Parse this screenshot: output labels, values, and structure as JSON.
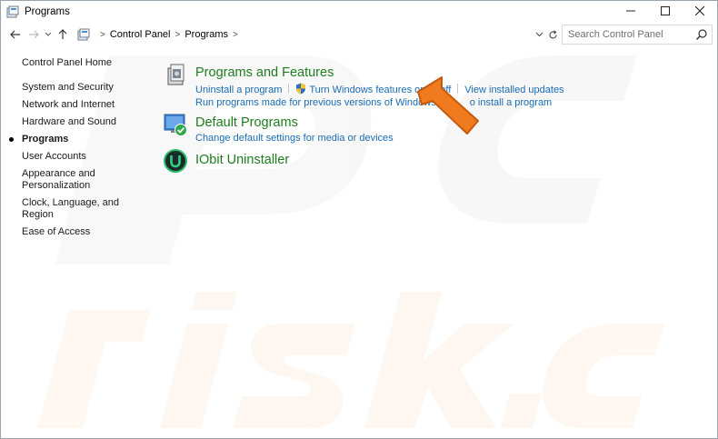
{
  "window": {
    "title": "Programs"
  },
  "addressbar": {
    "breadcrumbs": [
      "Control Panel",
      "Programs"
    ],
    "search_placeholder": "Search Control Panel"
  },
  "leftnav": {
    "home": "Control Panel Home",
    "items": [
      {
        "label": "System and Security",
        "active": false
      },
      {
        "label": "Network and Internet",
        "active": false
      },
      {
        "label": "Hardware and Sound",
        "active": false
      },
      {
        "label": "Programs",
        "active": true
      },
      {
        "label": "User Accounts",
        "active": false
      },
      {
        "label": "Appearance and\nPersonalization",
        "active": false
      },
      {
        "label": "Clock, Language, and Region",
        "active": false
      },
      {
        "label": "Ease of Access",
        "active": false
      }
    ]
  },
  "main": {
    "programs_features": {
      "title": "Programs and Features",
      "link_uninstall": "Uninstall a program",
      "link_windows_features": "Turn Windows features on or off",
      "link_installed_updates": "View installed updates",
      "link_run_old": "Run programs made for previous versions of Windows",
      "link_install": "How to install a program",
      "link_install_visible": "o install a program"
    },
    "default_programs": {
      "title": "Default Programs",
      "link_change_defaults": "Change default settings for media or devices"
    },
    "iobit": {
      "title": "IObit Uninstaller"
    }
  },
  "watermark": {
    "line1": "PC",
    "line2": "risk.com"
  },
  "colors": {
    "section_title": "#1e7c1e",
    "link": "#1a6bb5",
    "arrow": "#f07a1e"
  }
}
